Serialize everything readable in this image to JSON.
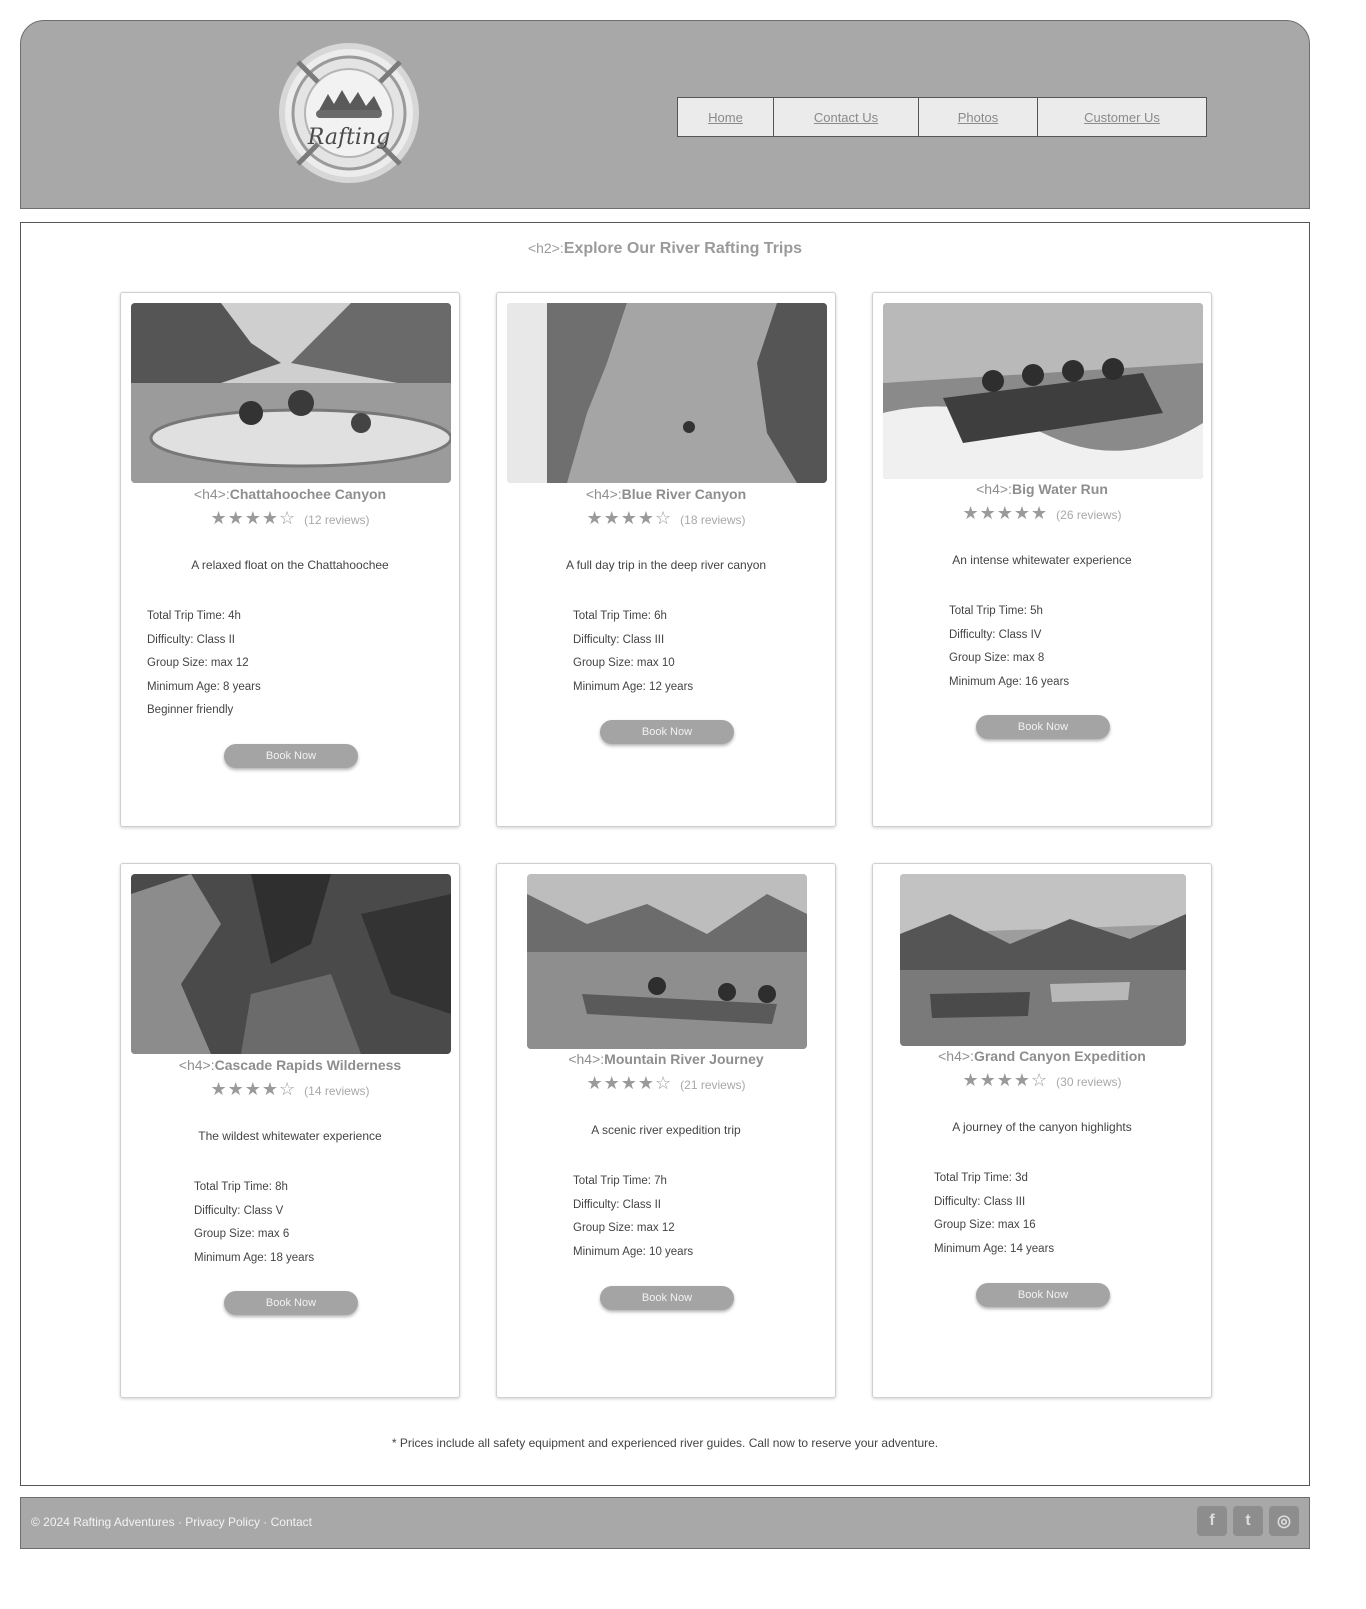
{
  "header": {
    "logo_top": "",
    "logo_bottom": "Rafting",
    "nav": [
      {
        "label": "Home"
      },
      {
        "label": "Contact Us"
      },
      {
        "label": "Photos"
      },
      {
        "label": "Customer Us"
      }
    ]
  },
  "main": {
    "title_tag": "<h2>:",
    "title": "Explore Our River Rafting Trips",
    "tag_h4": "<h4>:",
    "cards": [
      {
        "title": "Chattahoochee Canyon",
        "stars": "★★★★☆",
        "reviews": "(12 reviews)",
        "desc": "A relaxed float on the Chattahoochee",
        "details": [
          "Total Trip Time: 4h",
          "Difficulty: Class II",
          "Group Size: max 12",
          "Minimum Age: 8 years",
          "Beginner friendly"
        ],
        "button": "Book Now",
        "img": "canyon-raft"
      },
      {
        "title": "Blue River Canyon",
        "stars": "★★★★☆",
        "reviews": "(18 reviews)",
        "desc": "A full day trip in the deep river canyon",
        "details": [
          "Total Trip Time: 6h",
          "Difficulty: Class III",
          "Group Size: max 10",
          "Minimum Age: 12 years"
        ],
        "button": "Book Now",
        "img": "narrow-gorge"
      },
      {
        "title": "Big Water Run",
        "stars": "★★★★★",
        "reviews": "(26 reviews)",
        "desc": "An intense whitewater experience",
        "details": [
          "Total Trip Time: 5h",
          "Difficulty: Class IV",
          "Group Size: max 8",
          "Minimum Age: 16 years"
        ],
        "button": "Book Now",
        "img": "whitewater"
      },
      {
        "title": "Cascade Rapids Wilderness",
        "stars": "★★★★☆",
        "reviews": "(14 reviews)",
        "desc": "The wildest whitewater experience",
        "details": [
          "Total Trip Time: 8h",
          "Difficulty: Class V",
          "Group Size: max 6",
          "Minimum Age: 18 years"
        ],
        "button": "Book Now",
        "img": "rapids-closeup"
      },
      {
        "title": "Mountain River Journey",
        "stars": "★★★★☆",
        "reviews": "(21 reviews)",
        "desc": "A scenic river expedition trip",
        "details": [
          "Total Trip Time: 7h",
          "Difficulty: Class II",
          "Group Size: max 12",
          "Minimum Age: 10 years"
        ],
        "button": "Book Now",
        "img": "lake-paddle"
      },
      {
        "title": "Grand Canyon Expedition",
        "stars": "★★★★☆",
        "reviews": "(30 reviews)",
        "desc": "A journey of the canyon highlights",
        "details": [
          "Total Trip Time: 3d",
          "Difficulty: Class III",
          "Group Size: max 16",
          "Minimum Age: 14 years"
        ],
        "button": "Book Now",
        "img": "river-camp"
      }
    ],
    "footnote": "* Prices include all safety equipment and experienced river guides. Call now to reserve your adventure."
  },
  "footer": {
    "text": "© 2024 Rafting Adventures · Privacy Policy · Contact",
    "social": [
      {
        "name": "facebook-icon",
        "glyph": "f"
      },
      {
        "name": "twitter-icon",
        "glyph": "t"
      },
      {
        "name": "instagram-icon",
        "glyph": "◎"
      }
    ]
  }
}
